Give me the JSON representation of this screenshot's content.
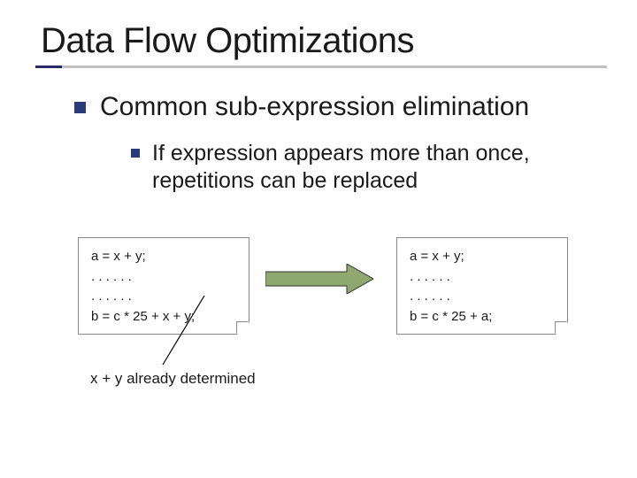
{
  "title": "Data Flow Optimizations",
  "bullet1": "Common sub-expression elimination",
  "bullet2": "If expression appears more than once, repetitions can be replaced",
  "code_left": {
    "l1": "a = x + y;",
    "l2": ". . . . . .",
    "l3": ". . . . . .",
    "l4": "b = c * 25 + x + y;"
  },
  "code_right": {
    "l1": "a = x + y;",
    "l2": ". . . . . .",
    "l3": ". . . . . .",
    "l4": "b = c * 25 + a;"
  },
  "annotation": "x + y already determined"
}
